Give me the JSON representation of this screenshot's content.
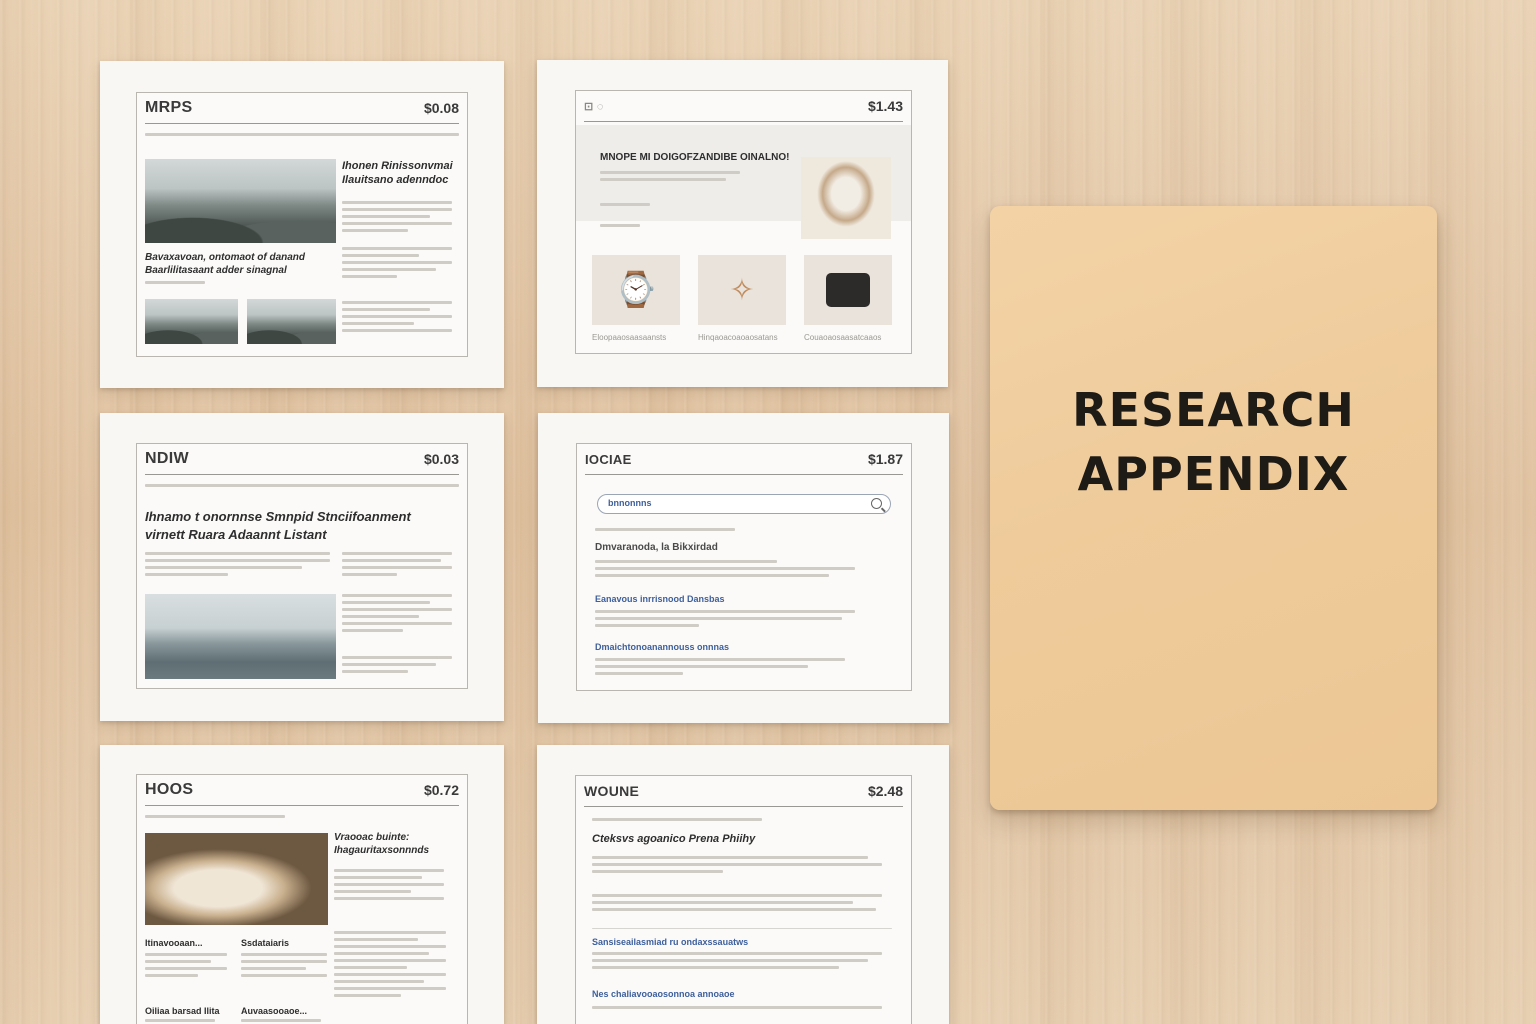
{
  "folder": {
    "line1": "RESEARCH",
    "line2": "APPENDIX"
  },
  "cards": [
    {
      "title": "MRPS",
      "price": "$0.08",
      "headline": "Ihonen Rinissonvmai Ilauitsano adenndoc",
      "caption": "Bavaxavoan, ontomaot of danand Baarlilitasaant adder sinagnal"
    },
    {
      "title": "",
      "price": "$1.43",
      "headline": "MNOPE MI DOIGOFZANDIBE OINALNO!",
      "products": [
        "Eloopaaosaasaansts",
        "Hinqaoacoaoaosatans",
        "Couaoaosaasatcaaos"
      ]
    },
    {
      "title": "NDIW",
      "price": "$0.03",
      "headline": "Ihnamo t onornnse Smnpid Stnciifoanment virnett Ruara Adaannt Listant"
    },
    {
      "title": "IOCIAE",
      "price": "$1.87",
      "search": "bnnonnns",
      "result1": "Dmvaranoda, la Bikxirdad",
      "link1": "Eanavous inrrisnood Dansbas",
      "link2": "Dmaichtonoanannouss onnnas"
    },
    {
      "title": "HOOS",
      "price": "$0.72",
      "headline": "Vraooac buinte: Ihagauritaxsonnnds",
      "sub1": "Itinavooaan...",
      "sub2": "Ssdataiaris",
      "sub3": "Oiliaa barsad Ilita",
      "sub4": "Auvaasooaoe..."
    },
    {
      "title": "WOUNE",
      "price": "$2.48",
      "headline": "Cteksvs agoanico Prena Phiihy",
      "link1": "Sansiseailasmiad ru ondaxssauatws",
      "link2": "Nes chaliavooaosonnoa annoaoe"
    }
  ]
}
